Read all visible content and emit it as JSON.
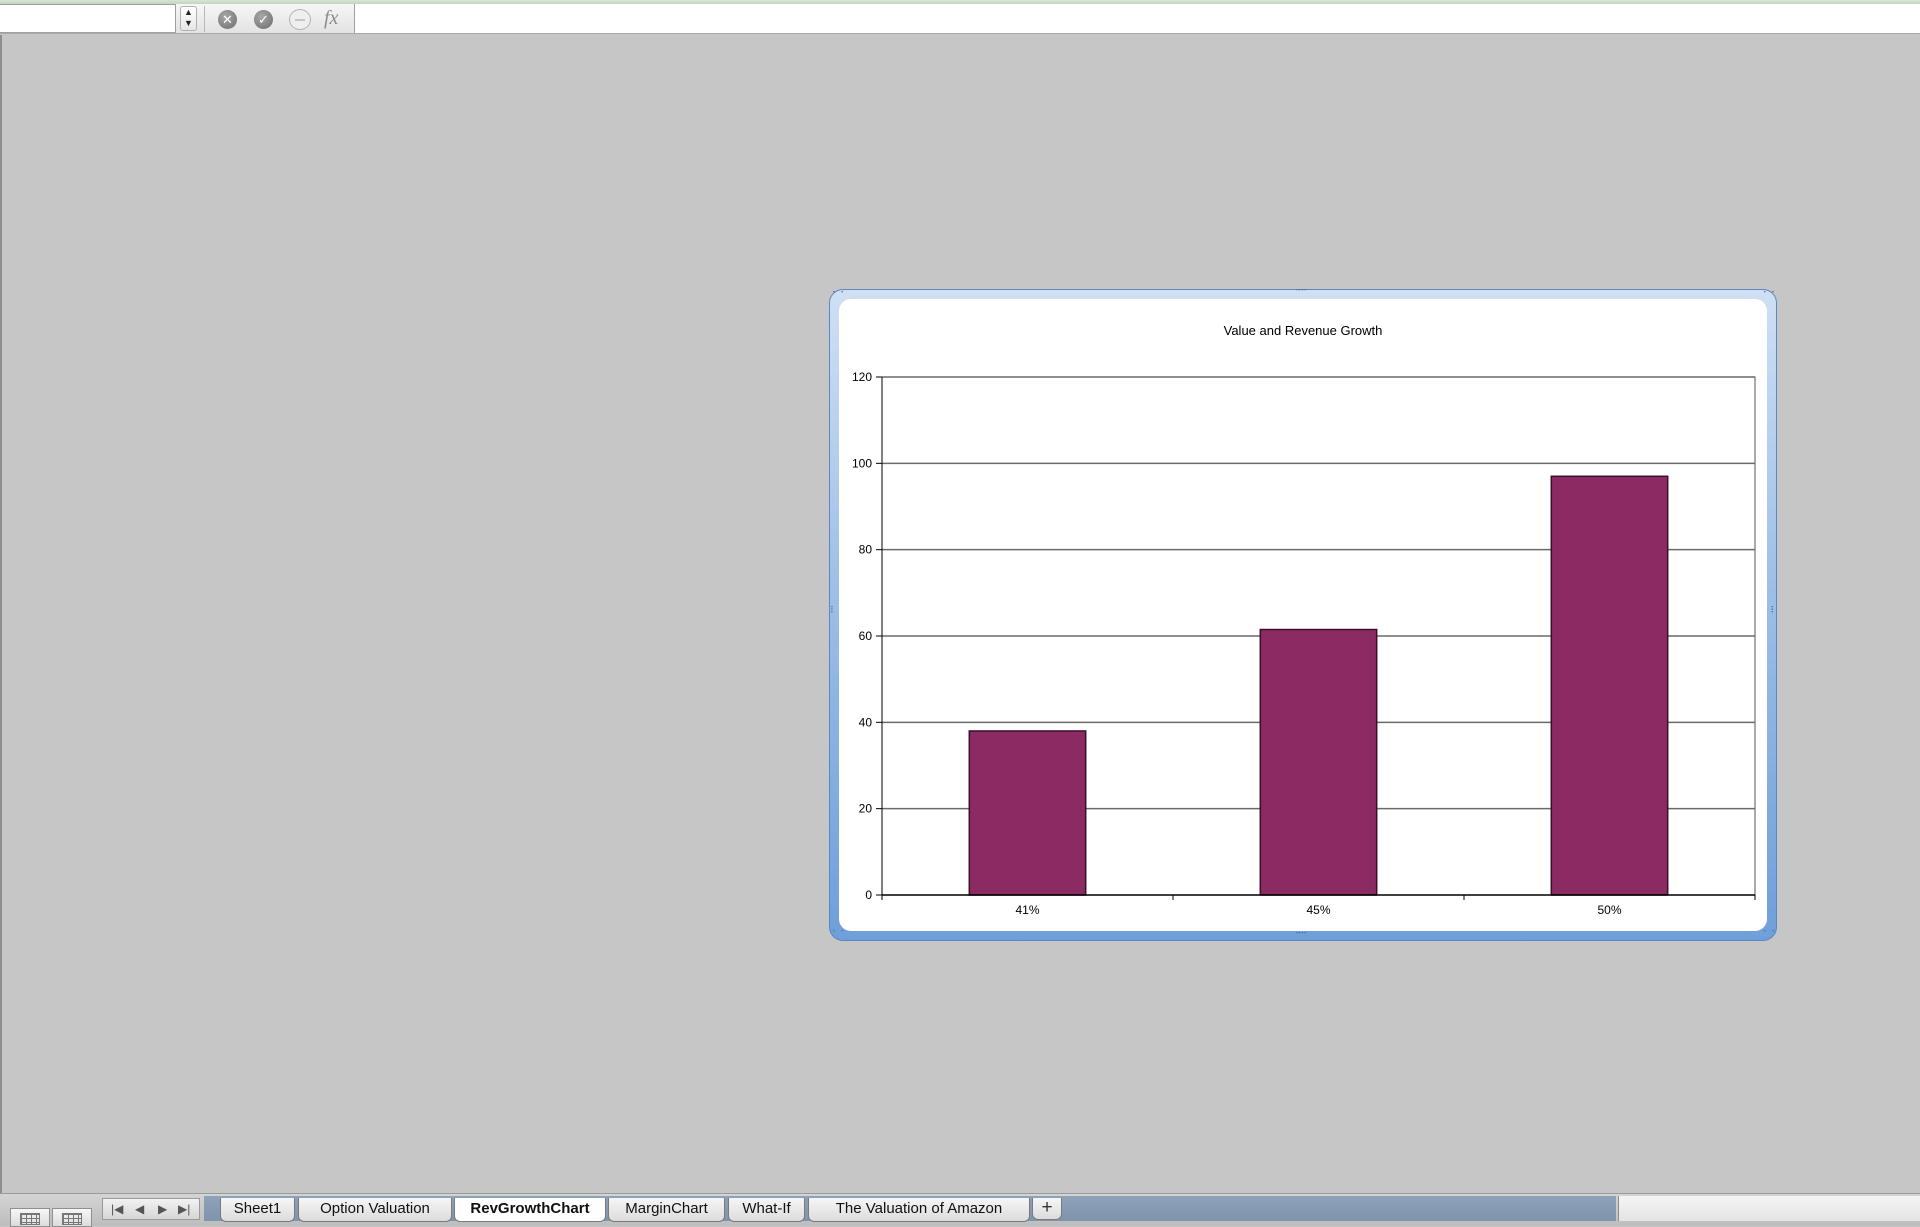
{
  "formula_bar": {
    "name_box_value": "",
    "formula_value": "",
    "cancel_icon": "x-circle-icon",
    "enter_icon": "checkmark-circle-icon",
    "insert_function_icon": "fx-icon",
    "fx_label": "fx"
  },
  "sheet_tabs": [
    {
      "label": "Sheet1",
      "active": false
    },
    {
      "label": "Option Valuation",
      "active": false
    },
    {
      "label": "RevGrowthChart",
      "active": true
    },
    {
      "label": "MarginChart",
      "active": false
    },
    {
      "label": "What-If",
      "active": false
    },
    {
      "label": "The Valuation of Amazon",
      "active": false
    }
  ],
  "add_sheet_label": "+",
  "colors": {
    "bar_fill": "#8b2a63",
    "bar_stroke": "#3b0f28",
    "sheet_background": "#c6c6c6",
    "chart_border": "#6f9fda"
  },
  "chart_data": {
    "type": "bar",
    "title": "Value and Revenue Growth",
    "categories": [
      "41%",
      "45%",
      "50%"
    ],
    "values": [
      38,
      61.5,
      97
    ],
    "ylim": [
      0,
      120
    ],
    "yticks": [
      0,
      20,
      40,
      60,
      80,
      100,
      120
    ],
    "ytick_labels": [
      "0",
      "20",
      "40",
      "60",
      "80",
      "100",
      "120"
    ],
    "grid": true,
    "legend": "none",
    "xlabel": "",
    "ylabel": ""
  }
}
